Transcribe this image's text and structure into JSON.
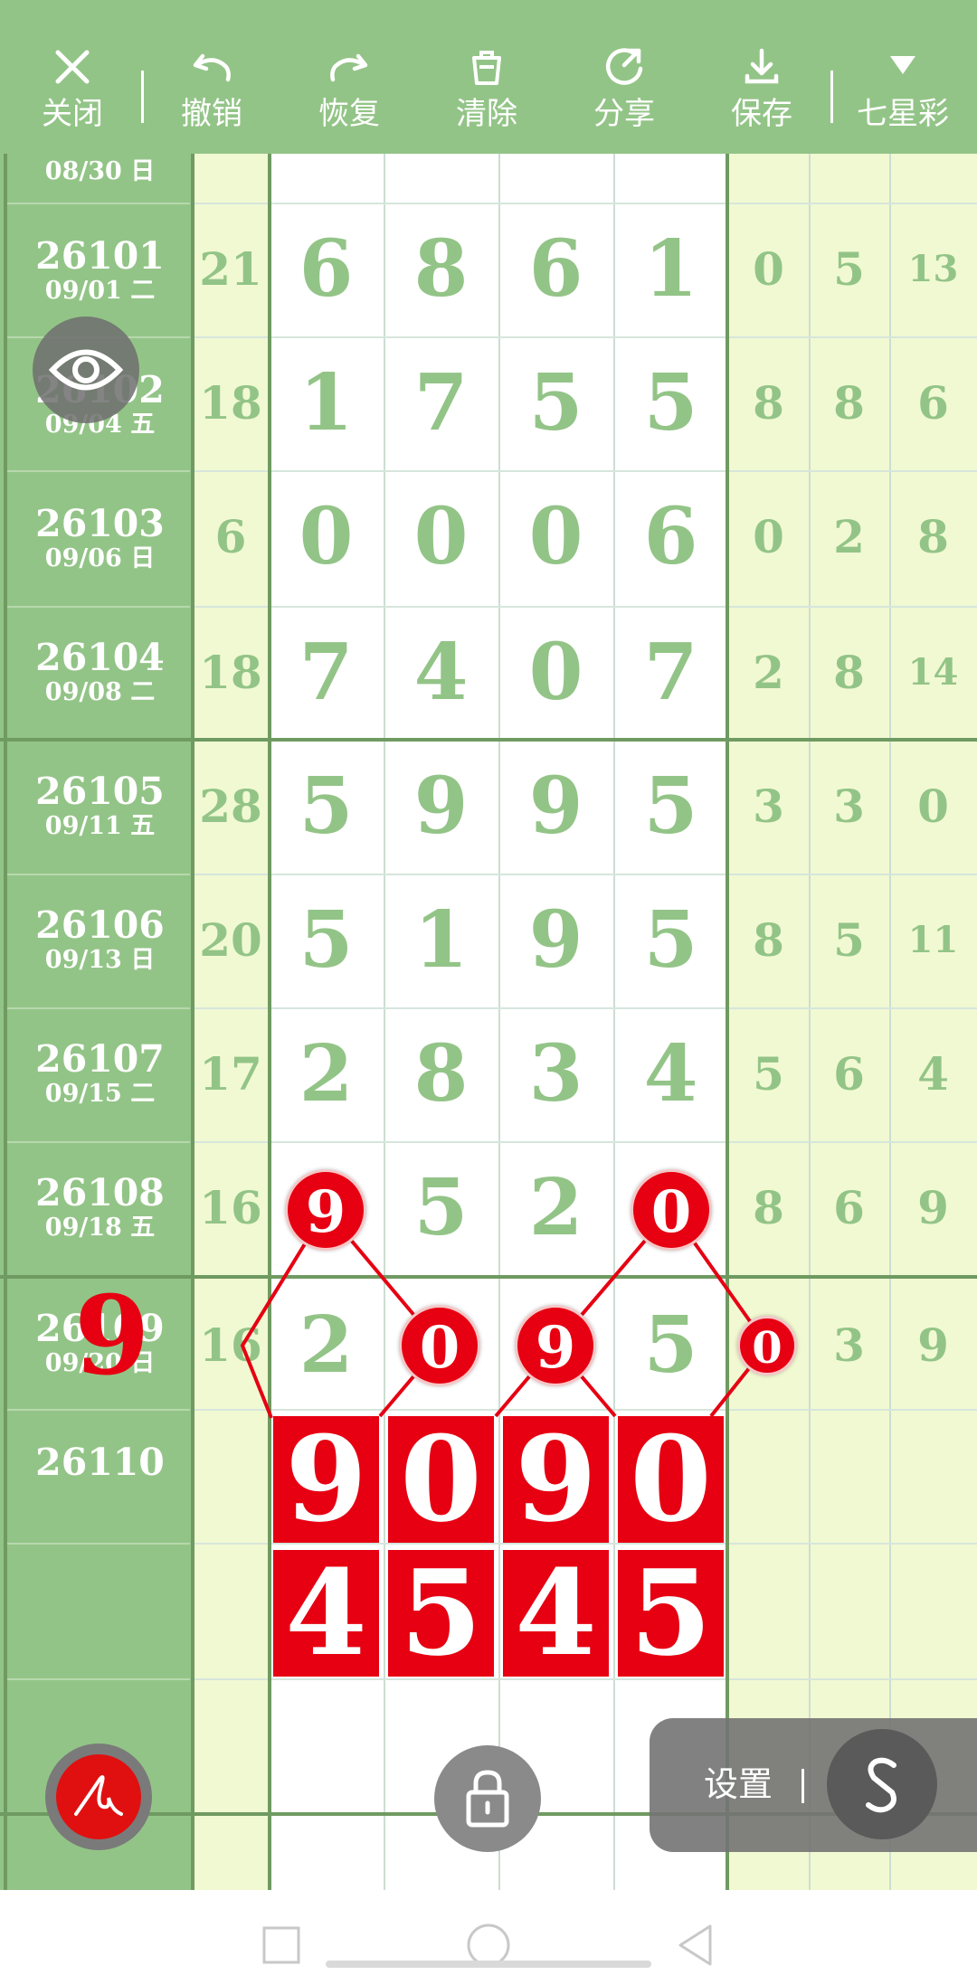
{
  "toolbar": {
    "items": [
      {
        "label": "关闭",
        "icon": "close-icon"
      },
      {
        "label": "撤销",
        "icon": "undo-icon"
      },
      {
        "label": "恢复",
        "icon": "redo-icon"
      },
      {
        "label": "清除",
        "icon": "trash-icon"
      },
      {
        "label": "分享",
        "icon": "share-icon"
      },
      {
        "label": "保存",
        "icon": "download-icon"
      },
      {
        "label": "七星彩",
        "icon": "triangle-down-icon"
      }
    ]
  },
  "rows": [
    {
      "id": "",
      "date": "08/30 日",
      "sum": "",
      "digits": [
        "",
        "",
        "",
        ""
      ],
      "ext": [
        "",
        "",
        ""
      ]
    },
    {
      "id": "26101",
      "date": "09/01 二",
      "sum": "21",
      "digits": [
        "6",
        "8",
        "6",
        "1"
      ],
      "ext": [
        "0",
        "5",
        "13"
      ]
    },
    {
      "id": "26102",
      "date": "09/04 五",
      "sum": "18",
      "digits": [
        "1",
        "7",
        "5",
        "5"
      ],
      "ext": [
        "8",
        "8",
        "6"
      ]
    },
    {
      "id": "26103",
      "date": "09/06 日",
      "sum": "6",
      "digits": [
        "0",
        "0",
        "0",
        "6"
      ],
      "ext": [
        "0",
        "2",
        "8"
      ]
    },
    {
      "id": "26104",
      "date": "09/08 二",
      "sum": "18",
      "digits": [
        "7",
        "4",
        "0",
        "7"
      ],
      "ext": [
        "2",
        "8",
        "14"
      ]
    },
    {
      "id": "26105",
      "date": "09/11 五",
      "sum": "28",
      "digits": [
        "5",
        "9",
        "9",
        "5"
      ],
      "ext": [
        "3",
        "3",
        "0"
      ]
    },
    {
      "id": "26106",
      "date": "09/13 日",
      "sum": "20",
      "digits": [
        "5",
        "1",
        "9",
        "5"
      ],
      "ext": [
        "8",
        "5",
        "11"
      ]
    },
    {
      "id": "26107",
      "date": "09/15 二",
      "sum": "17",
      "digits": [
        "2",
        "8",
        "3",
        "4"
      ],
      "ext": [
        "5",
        "6",
        "4"
      ]
    },
    {
      "id": "26108",
      "date": "09/18 五",
      "sum": "16",
      "digits": [
        "9",
        "5",
        "2",
        "0"
      ],
      "ext": [
        "8",
        "6",
        "9"
      ]
    },
    {
      "id": "26109",
      "date": "09/20 日",
      "sum": "16",
      "digits": [
        "2",
        "9",
        "0",
        "5"
      ],
      "ext": [
        "0",
        "3",
        "9"
      ]
    },
    {
      "id": "26110",
      "date": "",
      "sum": "",
      "digits": [
        "",
        "",
        "",
        ""
      ],
      "ext": [
        "",
        "",
        ""
      ]
    }
  ],
  "annotations": {
    "circled": [
      "9",
      "0",
      "9",
      "0",
      "0"
    ],
    "overlay_digit": "9",
    "prediction_row1": [
      "9",
      "0",
      "9",
      "0"
    ],
    "prediction_row2": [
      "4",
      "5",
      "4",
      "5"
    ]
  },
  "floating": {
    "settings_label": "设置",
    "s_button_label": "S"
  },
  "colors": {
    "theme_green": "#93c487",
    "cell_green_text": "#93c487",
    "pale_yellow": "#f1f9d2",
    "annotation_red": "#e60012"
  }
}
